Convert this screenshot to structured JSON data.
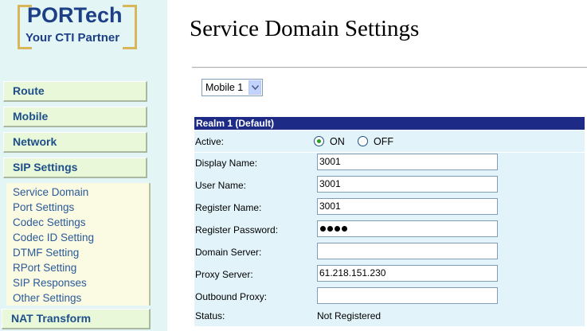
{
  "logo": {
    "brand": "PORTech",
    "tagline": "Your CTI Partner"
  },
  "nav": {
    "route": "Route",
    "mobile": "Mobile",
    "network": "Network",
    "sip_settings": "SIP Settings",
    "nat_transform": "NAT Transform"
  },
  "submenu": [
    "Service Domain",
    "Port Settings",
    "Codec Settings",
    "Codec ID Setting",
    "DTMF Setting",
    "RPort Setting",
    "SIP Responses",
    "Other Settings"
  ],
  "page": {
    "title": "Service Domain Settings"
  },
  "mobile_select": {
    "selected": "Mobile 1"
  },
  "realm": {
    "header": "Realm 1 (Default)",
    "active": {
      "label": "Active:",
      "on": "ON",
      "off": "OFF",
      "selected": "ON"
    },
    "display_name": {
      "label": "Display Name:",
      "value": "3001"
    },
    "user_name": {
      "label": "User Name:",
      "value": "3001"
    },
    "register_name": {
      "label": "Register Name:",
      "value": "3001"
    },
    "register_password": {
      "label": "Register Password:",
      "masked_length": 4
    },
    "domain_server": {
      "label": "Domain Server:",
      "value": ""
    },
    "proxy_server": {
      "label": "Proxy Server:",
      "value": "61.218.151.230"
    },
    "outbound_proxy": {
      "label": "Outbound Proxy:",
      "value": ""
    },
    "status": {
      "label": "Status:",
      "value": "Not Registered"
    }
  },
  "colors": {
    "sidebar_bg": "#e4f5f6",
    "nav_bg": "#e8f8d8",
    "nav_text": "#1e4f8c",
    "submenu_bg": "#fbfae3",
    "header_bg": "#1d2a86",
    "row_bg": "#e2f4fa",
    "logo_text": "#1c3f86",
    "logo_frame": "#d8b65a"
  }
}
